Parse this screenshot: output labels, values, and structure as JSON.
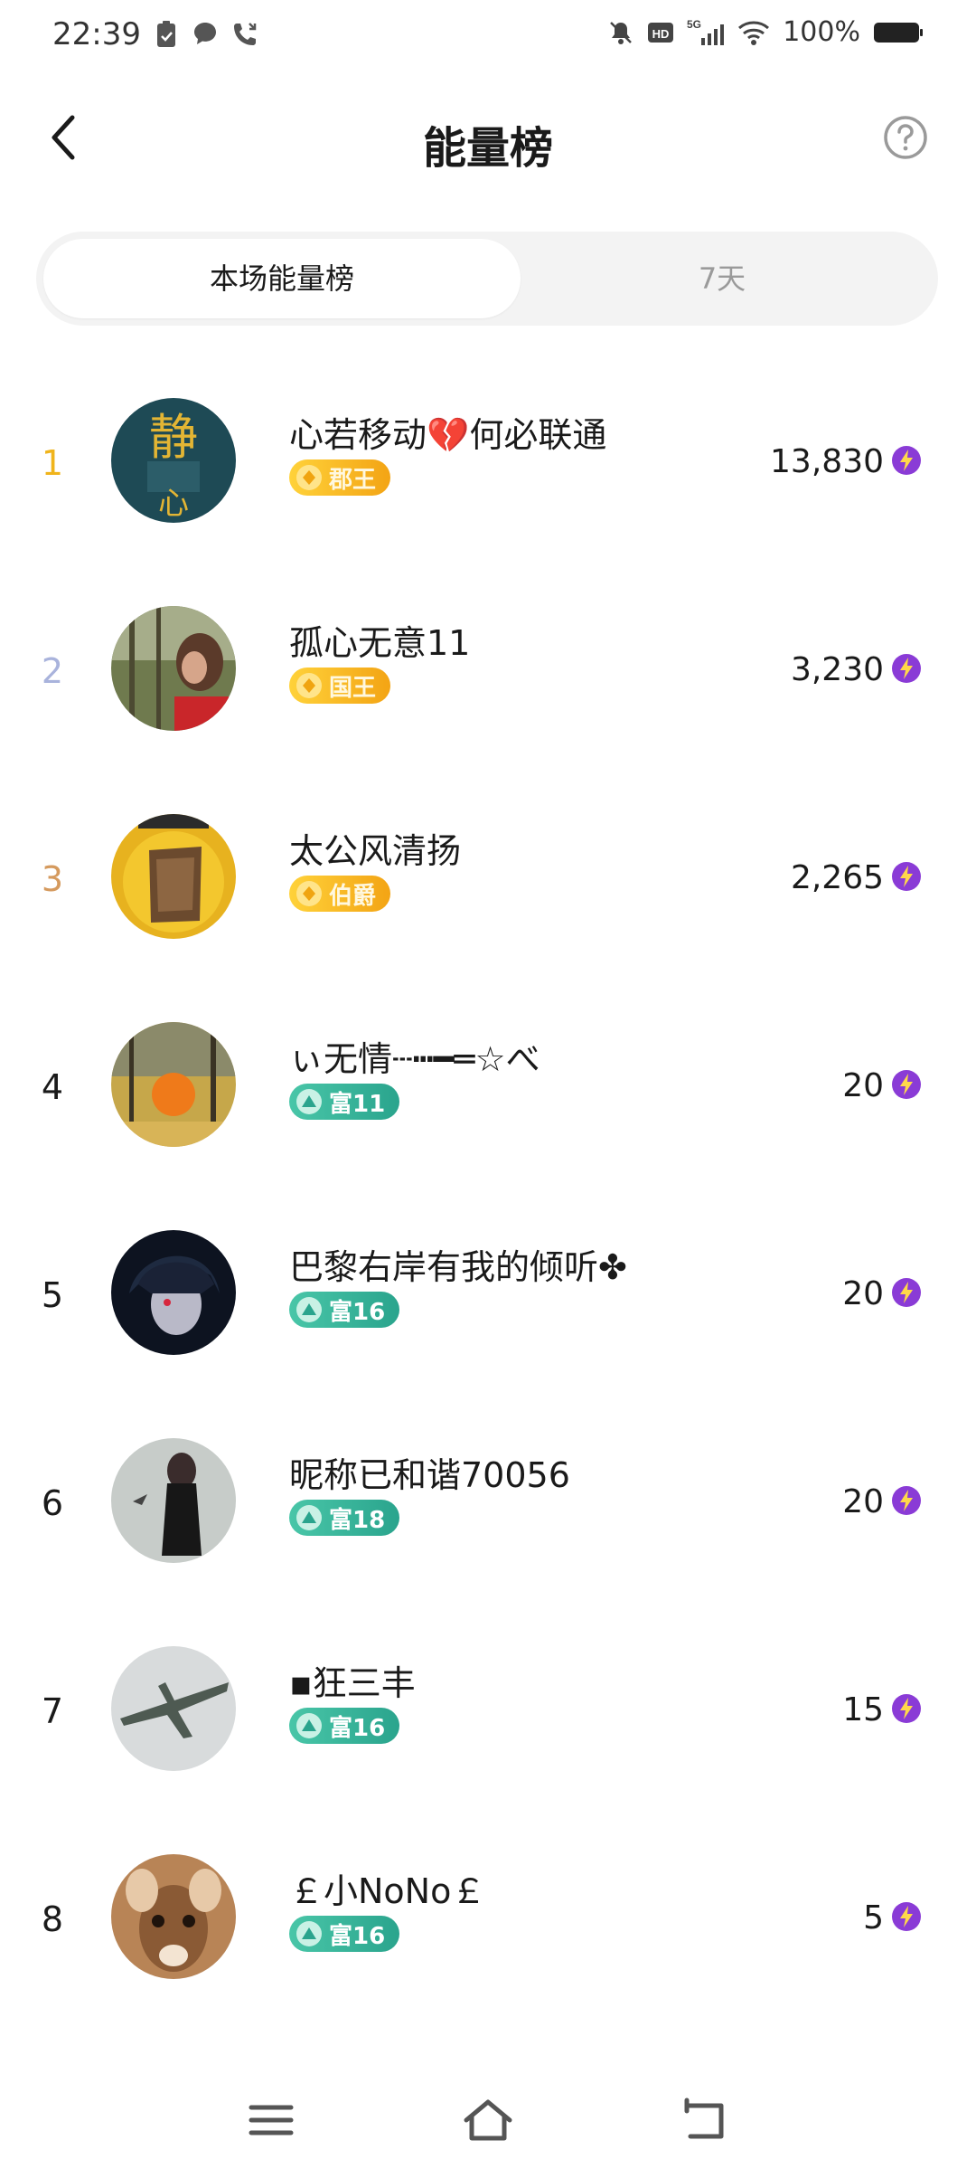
{
  "status_bar": {
    "time": "22:39",
    "battery": "100%",
    "network": "5G"
  },
  "header": {
    "title": "能量榜",
    "back_icon": "chevron-left-icon",
    "help_icon": "help-circle-icon"
  },
  "tabs": [
    {
      "label": "本场能量榜",
      "active": true
    },
    {
      "label": "7天",
      "active": false
    }
  ],
  "leaderboard": [
    {
      "rank": "1",
      "rank_color": "#f0b41b",
      "name": "心若移动💔何必联通",
      "badge": "郡王",
      "badge_type": "gold",
      "score": "13,830"
    },
    {
      "rank": "2",
      "rank_color": "#a9b3dc",
      "name": "孤心无意11",
      "badge": "国王",
      "badge_type": "gold",
      "score": "3,230"
    },
    {
      "rank": "3",
      "rank_color": "#d59a5e",
      "name": "太公风清扬",
      "badge": "伯爵",
      "badge_type": "gold",
      "score": "2,265"
    },
    {
      "rank": "4",
      "rank_color": "#1a1a1a",
      "name": "ぃ无情┄┅━═☆べ",
      "badge": "富11",
      "badge_type": "teal",
      "score": "20"
    },
    {
      "rank": "5",
      "rank_color": "#1a1a1a",
      "name": "巴黎右岸有我的倾听✤",
      "badge": "富16",
      "badge_type": "teal",
      "score": "20"
    },
    {
      "rank": "6",
      "rank_color": "#1a1a1a",
      "name": "昵称已和谐70056",
      "badge": "富18",
      "badge_type": "teal",
      "score": "20"
    },
    {
      "rank": "7",
      "rank_color": "#1a1a1a",
      "name": "▪狂三丰",
      "badge": "富16",
      "badge_type": "teal",
      "score": "15"
    },
    {
      "rank": "8",
      "rank_color": "#1a1a1a",
      "name": "￡小NoNo￡",
      "badge": "富16",
      "badge_type": "teal",
      "score": "5"
    }
  ],
  "colors": {
    "accent_gold": "#f3a414",
    "accent_teal": "#2aa48d",
    "energy_icon": "#8a3bd6"
  },
  "nav_icons": [
    "menu-icon",
    "home-icon",
    "back-icon"
  ]
}
